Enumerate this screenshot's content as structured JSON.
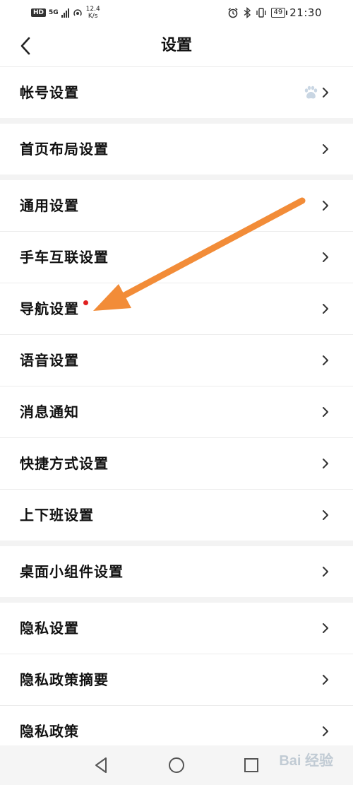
{
  "status_bar": {
    "hd": "HD",
    "network": "5G",
    "speed_value": "12.4",
    "speed_unit": "K/s",
    "battery": "49",
    "time": "21:30"
  },
  "header": {
    "title": "设置"
  },
  "sections": [
    {
      "items": [
        {
          "label": "帐号设置",
          "has_paw_icon": true
        }
      ]
    },
    {
      "items": [
        {
          "label": "首页布局设置"
        }
      ]
    },
    {
      "items": [
        {
          "label": "通用设置"
        },
        {
          "label": "手车互联设置"
        },
        {
          "label": "导航设置",
          "badge": "red-dot"
        },
        {
          "label": "语音设置"
        },
        {
          "label": "消息通知"
        },
        {
          "label": "快捷方式设置"
        },
        {
          "label": "上下班设置"
        }
      ]
    },
    {
      "items": [
        {
          "label": "桌面小组件设置"
        }
      ]
    },
    {
      "items": [
        {
          "label": "隐私设置"
        },
        {
          "label": "隐私政策摘要"
        },
        {
          "label": "隐私政策"
        }
      ]
    }
  ],
  "watermark": "Bai 经验",
  "colors": {
    "arrow": "#f28c38",
    "badge": "#e02020",
    "divider": "#ececec",
    "section_gap": "#f3f3f3"
  }
}
